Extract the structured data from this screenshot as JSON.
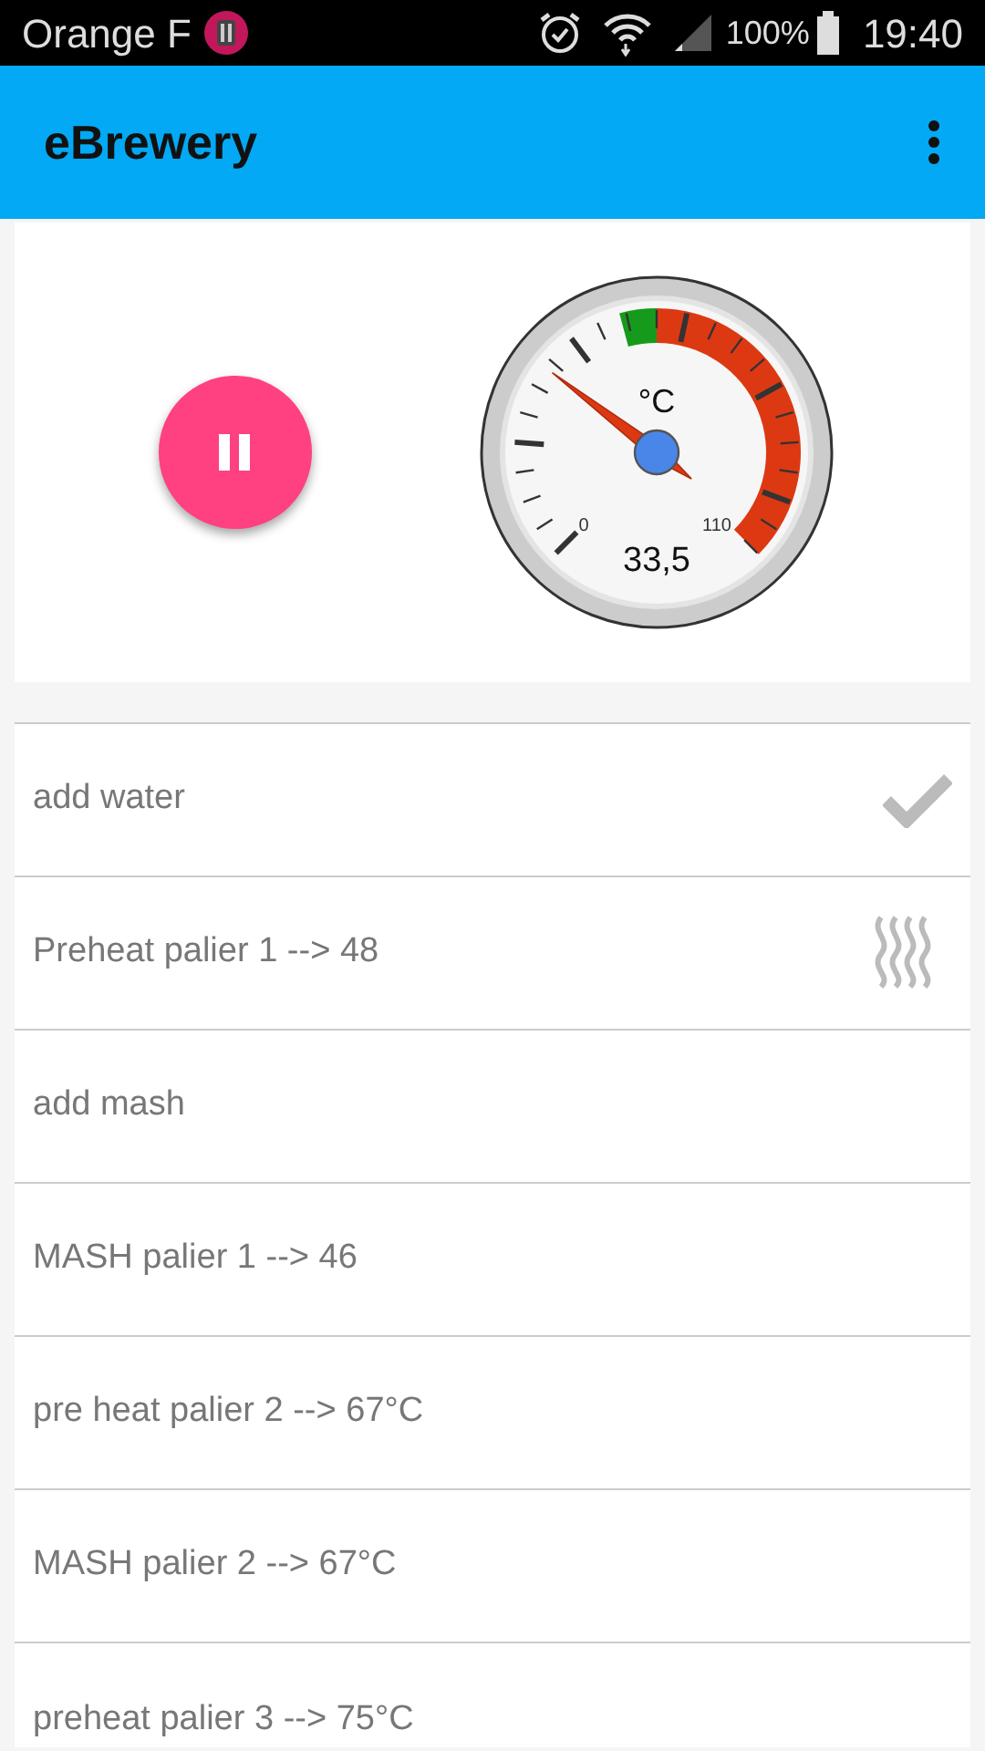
{
  "status_bar": {
    "carrier": "Orange F",
    "battery": "100%",
    "time": "19:40"
  },
  "app_bar": {
    "title": "eBrewery"
  },
  "control": {
    "paused": false
  },
  "gauge": {
    "unit": "°C",
    "min_label": "0",
    "max_label": "110",
    "reading": "33,5"
  },
  "steps": [
    {
      "label": "add water",
      "kind": "done"
    },
    {
      "label": "Preheat palier 1 --> 48",
      "kind": "heating"
    },
    {
      "label": "add mash",
      "kind": "pending"
    },
    {
      "label": "MASH palier 1 --> 46",
      "kind": "pending"
    },
    {
      "label": "pre heat palier 2 --> 67°C",
      "kind": "pending"
    },
    {
      "label": "MASH palier 2 --> 67°C",
      "kind": "pending"
    },
    {
      "label": "preheat palier 3 --> 75°C",
      "kind": "pending"
    }
  ]
}
